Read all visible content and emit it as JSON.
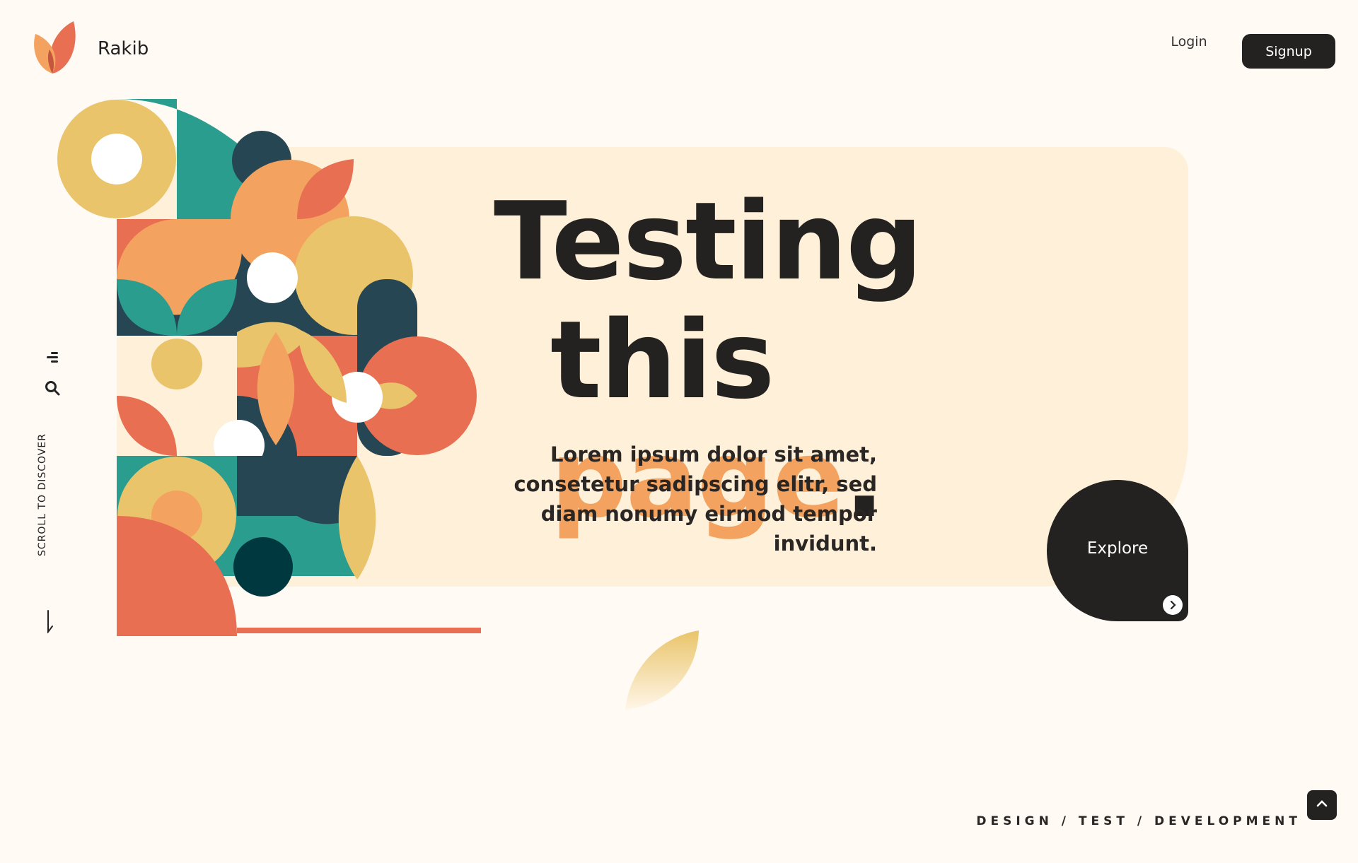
{
  "brand": {
    "name": "Rakib",
    "logo_icon": "leaf-logo-icon"
  },
  "nav": {
    "login_label": "Login",
    "signup_label": "Signup"
  },
  "hero": {
    "title_line1": "Testing",
    "title_line2_word": "this",
    "title_accent": "page",
    "title_period": ".",
    "description": "Lorem ipsum dolor sit amet, consetetur sadipscing elitr, sed diam nonumy eirmod tempor invidunt.",
    "explore_label": "Explore"
  },
  "sidebar": {
    "menu_icon": "menu-icon",
    "search_icon": "search-icon",
    "scroll_text": "SCROLL TO DISCOVER",
    "arrow_icon": "arrow-down-icon"
  },
  "footer": {
    "tagline": "DESIGN / TEST / DEVELOPMENT",
    "top_icon": "chevron-up-icon"
  },
  "colors": {
    "background": "#fffaf4",
    "panel": "#fff0d9",
    "dark": "#242220",
    "accent_orange": "#f3a35f",
    "coral": "#e86f52",
    "teal": "#2a9d8f",
    "navy": "#264653",
    "mustard": "#e9c46a"
  }
}
